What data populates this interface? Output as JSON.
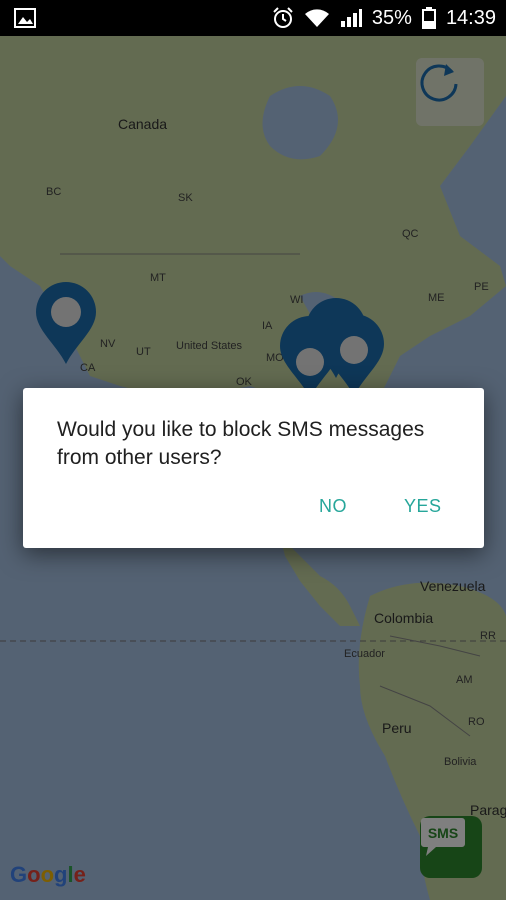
{
  "status_bar": {
    "battery": "35%",
    "time": "14:39",
    "icons": [
      "image-icon",
      "alarm-icon",
      "wifi-icon",
      "signal-icon",
      "battery-icon"
    ]
  },
  "map": {
    "labels": {
      "canada": "Canada",
      "bc": "BC",
      "sk": "SK",
      "qc": "QC",
      "mt": "MT",
      "wi": "WI",
      "me": "ME",
      "pe": "PE",
      "ia": "IA",
      "nv": "NV",
      "ut": "UT",
      "ca": "CA",
      "united_states": "United States",
      "mo": "MO",
      "ok": "OK",
      "venezuela": "Venezuela",
      "colombia": "Colombia",
      "rr": "RR",
      "ecuador": "Ecuador",
      "am": "AM",
      "peru": "Peru",
      "ro": "RO",
      "bolivia": "Bolivia",
      "paraguay": "Parag"
    },
    "attribution": "Google",
    "colors": {
      "pin": "#1c6fb0",
      "land": "#c7d6a3",
      "water": "#a9c5e6"
    }
  },
  "buttons": {
    "refresh_icon": "refresh-icon",
    "sms_label": "SMS"
  },
  "dialog": {
    "message": "Would you like to block SMS messages from other users?",
    "no_label": "NO",
    "yes_label": "YES",
    "accent": "#26a69a"
  }
}
